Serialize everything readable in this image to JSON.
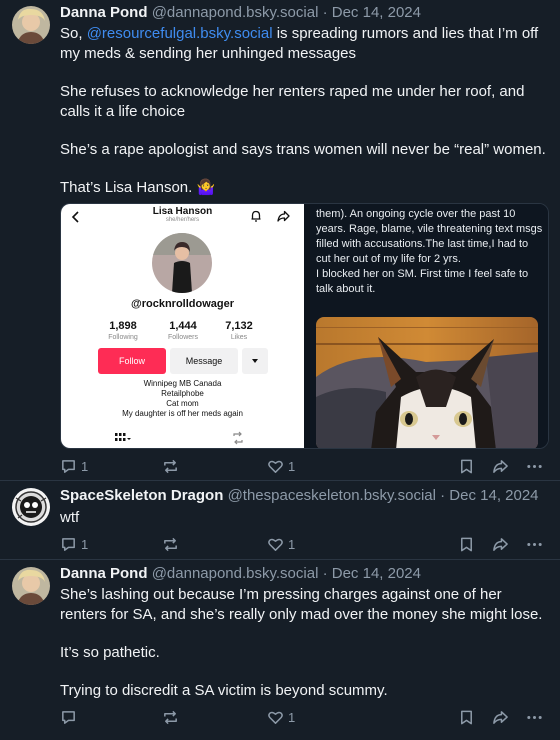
{
  "posts": [
    {
      "author": "Danna Pond",
      "handle": "@dannapond.bsky.social",
      "date": "· Dec 14, 2024",
      "text_prefix": "So, ",
      "mention": "@resourcefulgal.bsky.social",
      "text_suffix": " is spreading rumors and lies that I’m off my meds & sending her unhinged messages",
      "paragraphs": [
        "She refuses to acknowledge her renters raped me under her roof, and calls it a life choice",
        "She’s a rape apologist and says trans women will never be “real” women.",
        "That’s Lisa Hanson. 🤷‍♀️"
      ],
      "replies": "1",
      "reposts": "",
      "likes": "1"
    },
    {
      "author": "SpaceSkeleton Dragon",
      "handle": "@thespaceskeleton.bsky.social",
      "date": "· Dec 14, 2024",
      "text": "wtf",
      "replies": "1",
      "reposts": "",
      "likes": "1"
    },
    {
      "author": "Danna Pond",
      "handle": "@dannapond.bsky.social",
      "date": "· Dec 14, 2024",
      "paragraphs": [
        "She’s lashing out because I’m pressing charges against one of her renters for SA, and she’s really only mad over the money she might lose.",
        "It’s so pathetic.",
        "Trying to discredit a SA victim is beyond scummy."
      ],
      "replies": "",
      "reposts": "",
      "likes": "1"
    }
  ],
  "embed": {
    "profile": {
      "name": "Lisa Hanson",
      "pronouns": "she/her/hers",
      "username": "@rocknrolldowager",
      "following_count": "1,898",
      "following_label": "Following",
      "followers_count": "1,444",
      "followers_label": "Followers",
      "likes_count": "7,132",
      "likes_label": "Likes",
      "follow_button": "Follow",
      "message_button": "Message",
      "bio": [
        "Winnipeg MB Canada",
        "Retailphobe",
        "Cat mom",
        "My daughter is off her meds again"
      ]
    },
    "right_text": "them). An ongoing cycle over the past 10 years. Rage, blame, vile threatening text msgs filled with accusations.The last time,I had to cut her out of my life for 2 yrs.\nI blocked her on SM. First time I feel safe to talk about it."
  },
  "icons": {
    "reply": "reply-icon",
    "repost": "repost-icon",
    "like": "heart-icon",
    "bookmark": "bookmark-icon",
    "share": "share-icon",
    "more": "more-icon"
  },
  "colors": {
    "background": "#161e27",
    "mention": "#3f8cf0",
    "muted": "#8d9aa8",
    "follow": "#fe2c55"
  }
}
